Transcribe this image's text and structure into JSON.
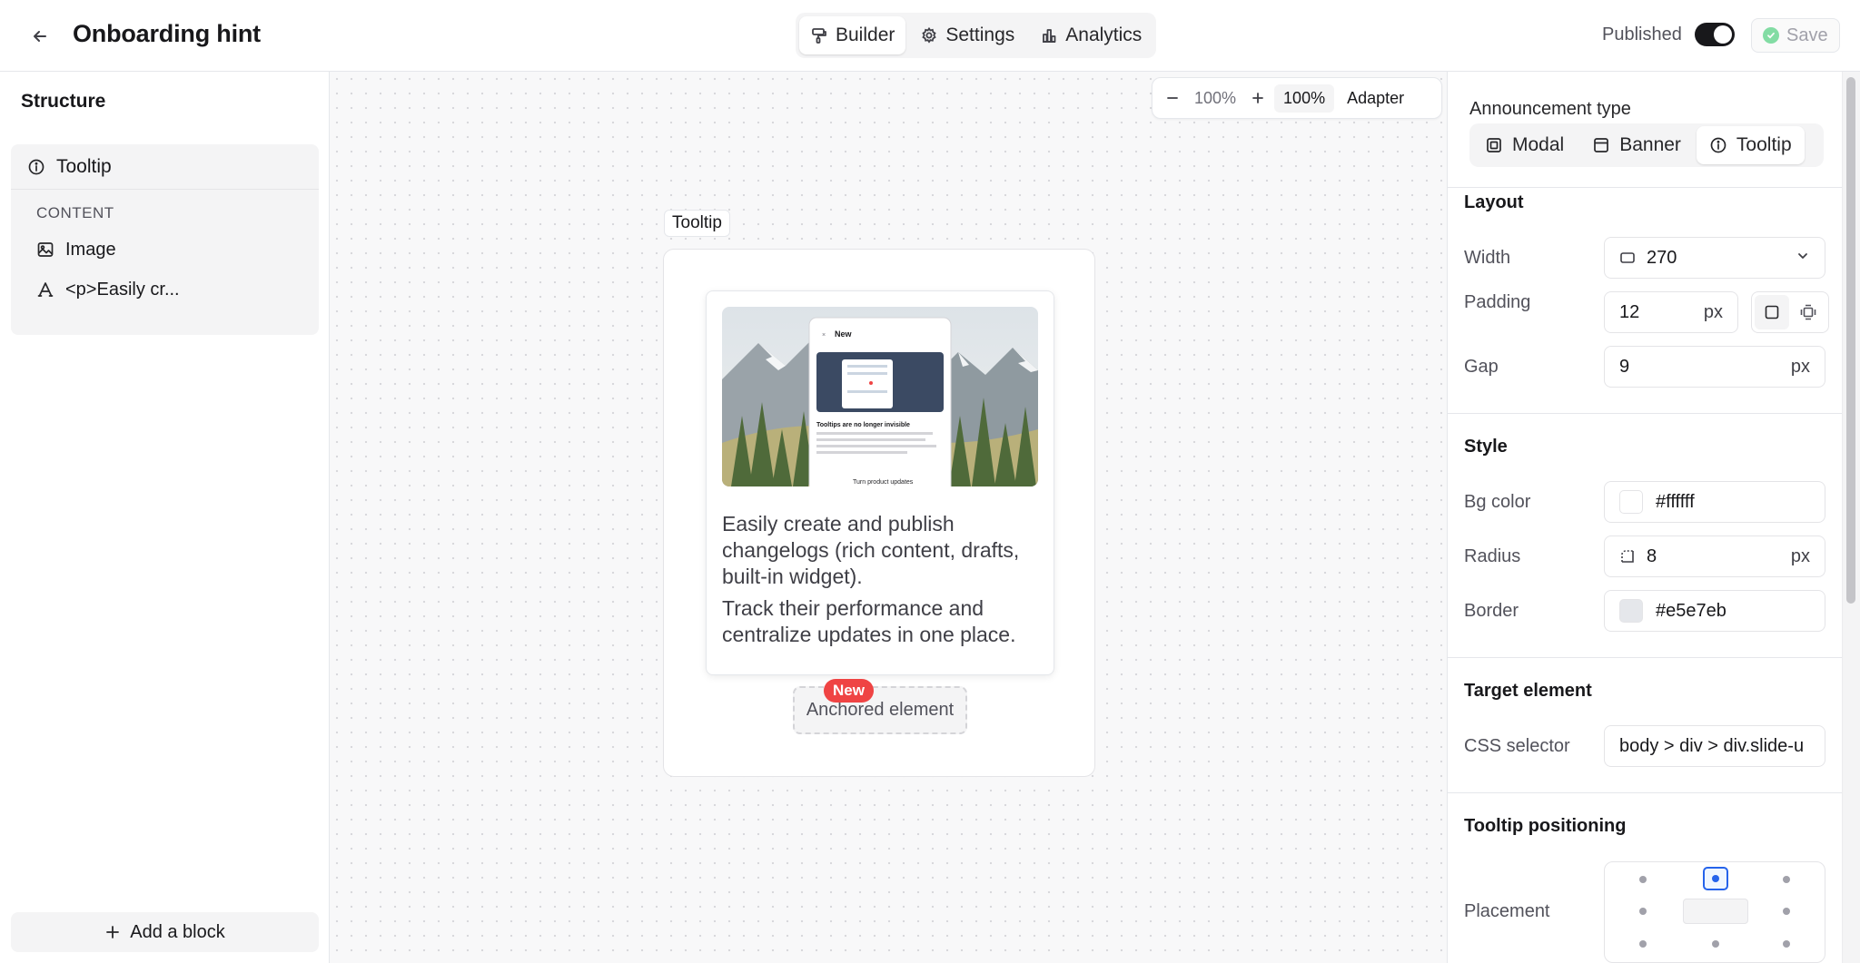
{
  "header": {
    "title": "Onboarding hint",
    "tabs": [
      {
        "label": "Builder",
        "icon": "brush-icon",
        "active": true
      },
      {
        "label": "Settings",
        "icon": "gear-icon",
        "active": false
      },
      {
        "label": "Analytics",
        "icon": "bar-chart-icon",
        "active": false
      }
    ],
    "published_label": "Published",
    "published_on": true,
    "save_label": "Save"
  },
  "sidebar": {
    "title": "Structure",
    "root_item": "Tooltip",
    "section_label": "CONTENT",
    "items": [
      {
        "label": "Image",
        "icon": "image-icon"
      },
      {
        "label": "<p>Easily cr...",
        "icon": "text-icon"
      }
    ],
    "add_block_label": "Add a block"
  },
  "canvas": {
    "zoom": {
      "level": "100%",
      "chip": "100%",
      "adapter": "Adapter"
    },
    "tooltip_label": "Tooltip",
    "preview": {
      "image_mini": {
        "new_label": "New",
        "headline": "Tooltips are no longer invisible",
        "cta": "Turn product updates"
      },
      "paragraph_1": "Easily create and publish changelogs (rich content, drafts, built-in widget).",
      "paragraph_2": "Track their performance and centralize updates in one place."
    },
    "anchored_label": "Anchored element",
    "badge_label": "New",
    "badge_color": "#ef4444"
  },
  "panel": {
    "announcement_type_label": "Announcement type",
    "types": [
      {
        "label": "Modal",
        "icon": "modal-icon",
        "active": false
      },
      {
        "label": "Banner",
        "icon": "banner-icon",
        "active": false
      },
      {
        "label": "Tooltip",
        "icon": "info-icon",
        "active": true
      }
    ],
    "layout": {
      "title": "Layout",
      "width_label": "Width",
      "width_value": "270",
      "padding_label": "Padding",
      "padding_value": "12",
      "padding_unit": "px",
      "gap_label": "Gap",
      "gap_value": "9",
      "gap_unit": "px"
    },
    "style": {
      "title": "Style",
      "bg_label": "Bg color",
      "bg_value": "#ffffff",
      "radius_label": "Radius",
      "radius_value": "8",
      "radius_unit": "px",
      "border_label": "Border",
      "border_value": "#e5e7eb"
    },
    "target": {
      "title": "Target element",
      "selector_label": "CSS selector",
      "selector_value": "body > div > div.slide-u"
    },
    "positioning": {
      "title": "Tooltip positioning",
      "placement_label": "Placement",
      "selected": "top"
    }
  }
}
